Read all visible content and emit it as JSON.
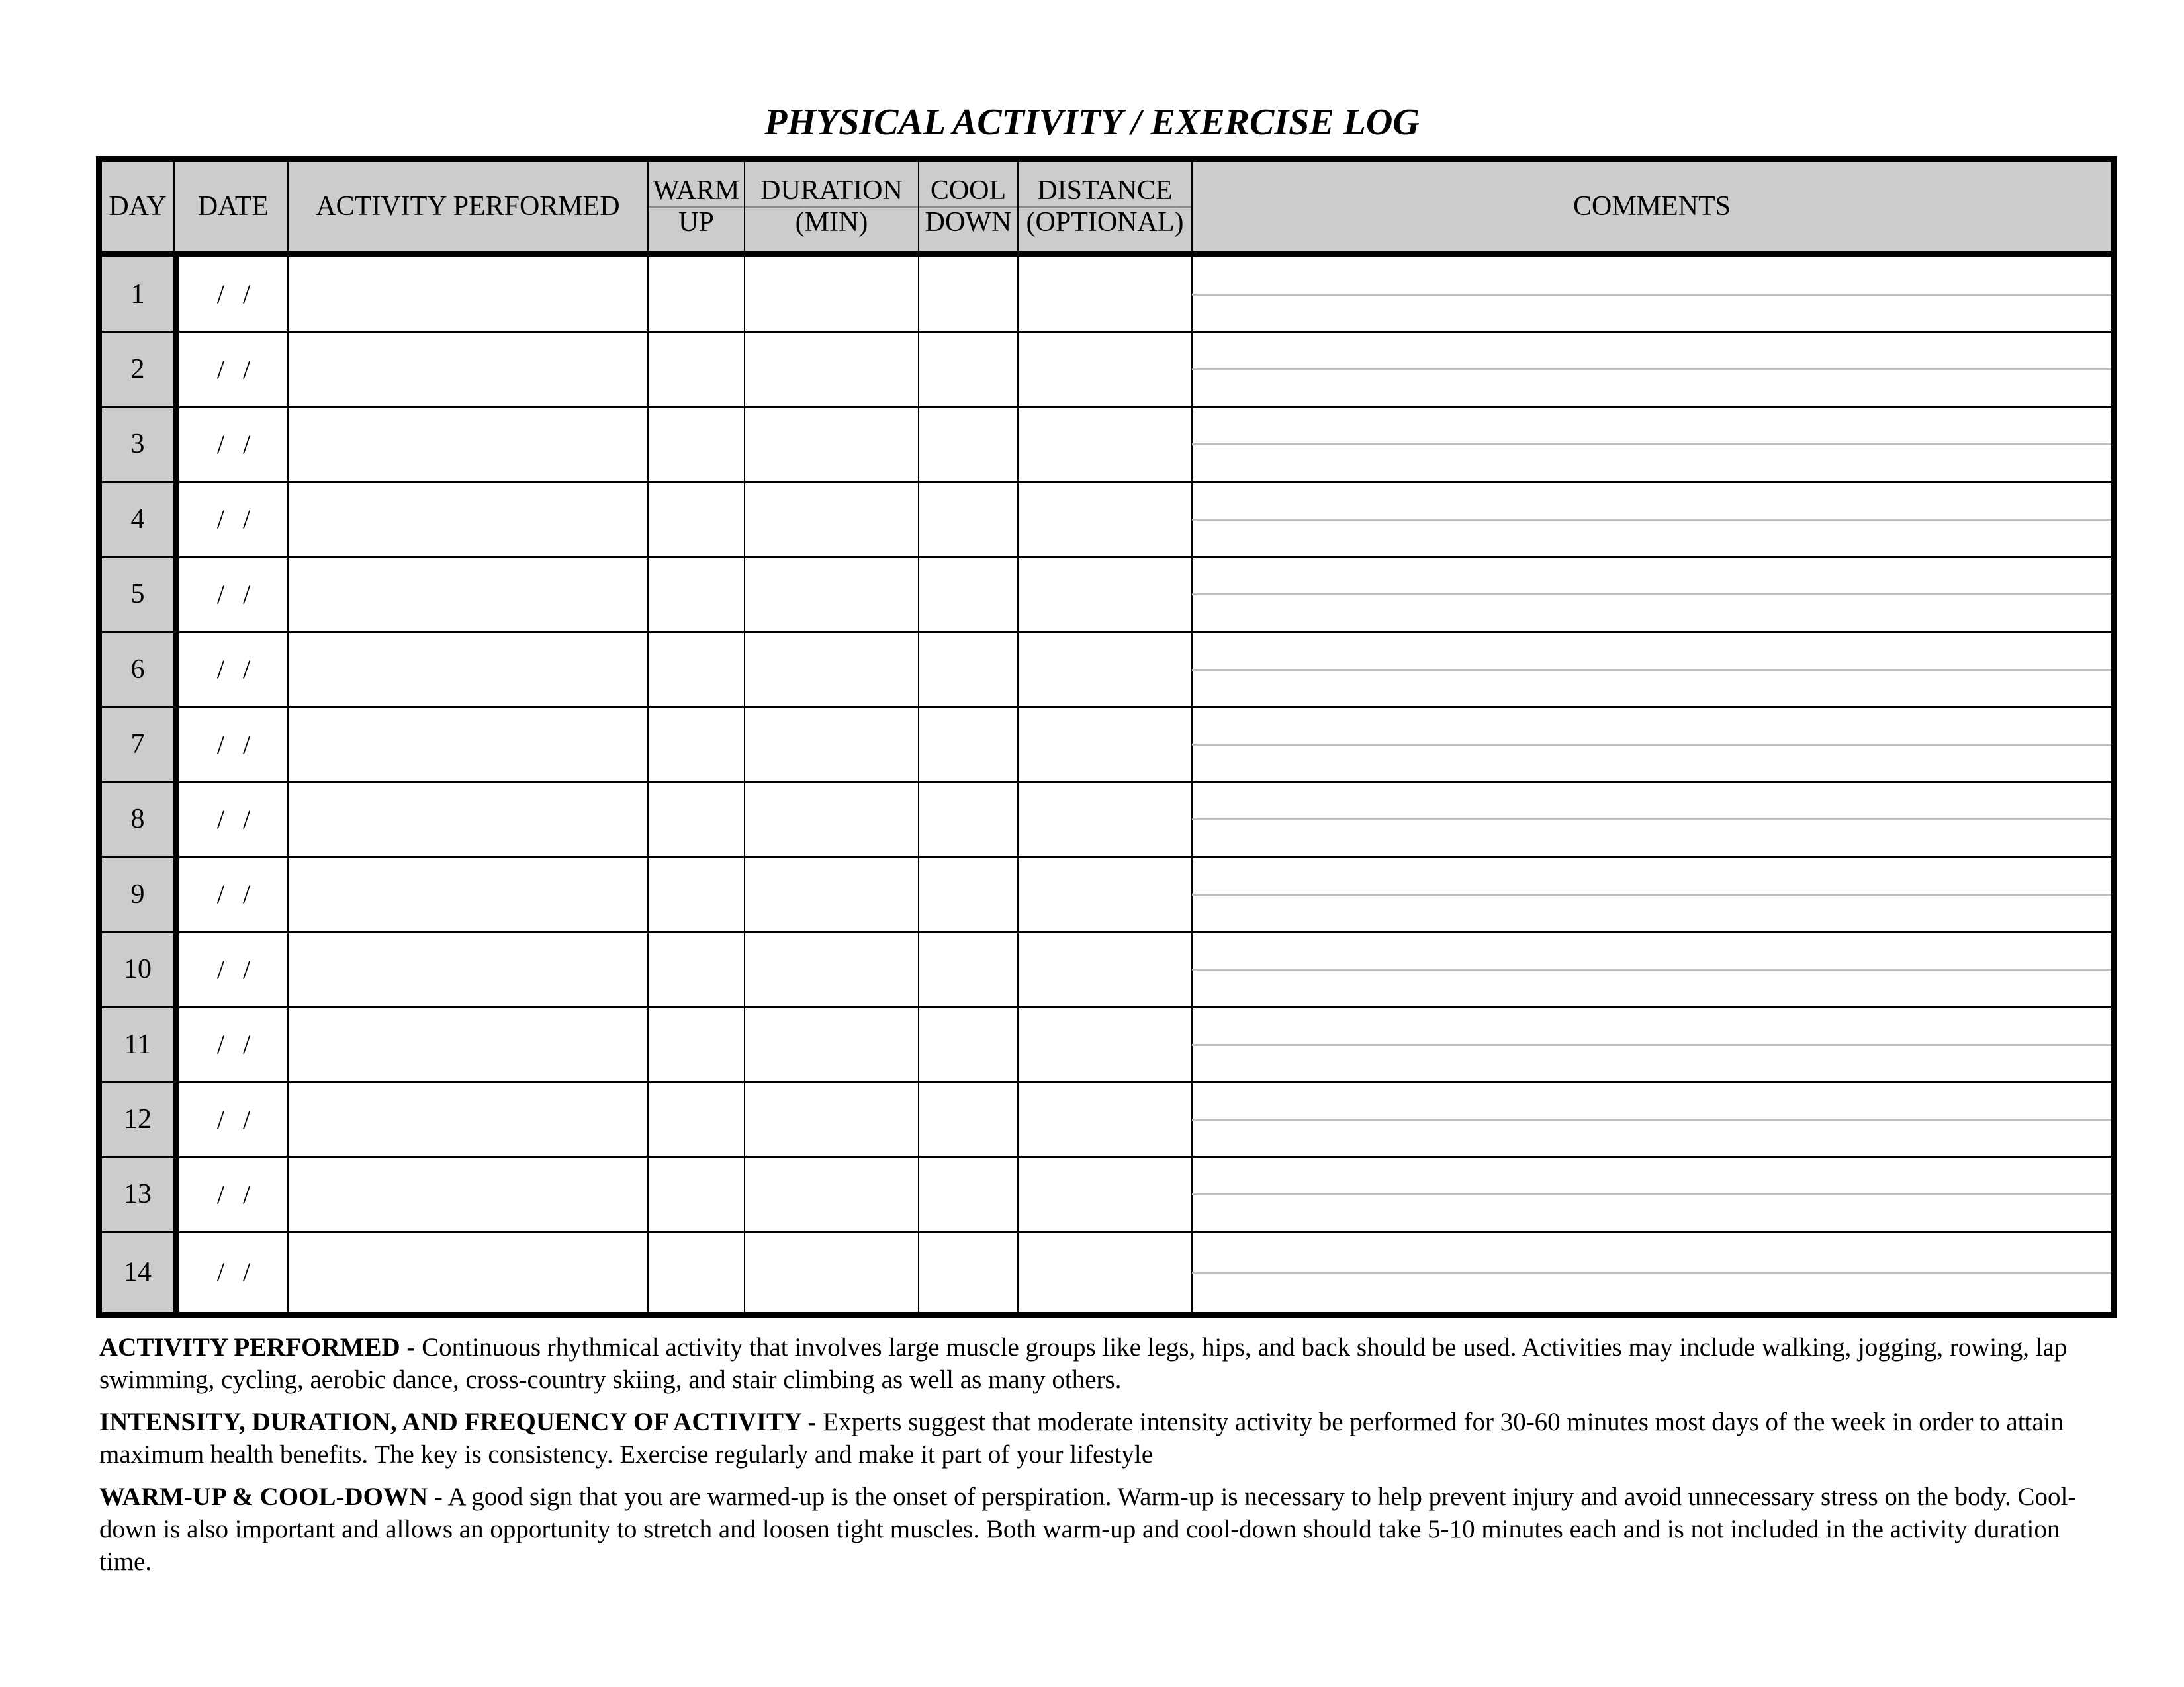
{
  "title": "PHYSICAL ACTIVITY / EXERCISE LOG",
  "columns": [
    {
      "key": "day",
      "line1": "DAY",
      "line2": ""
    },
    {
      "key": "date",
      "line1": "DATE",
      "line2": ""
    },
    {
      "key": "activity",
      "line1": "ACTIVITY PERFORMED",
      "line2": ""
    },
    {
      "key": "warmup",
      "line1": "WARM",
      "line2": "UP"
    },
    {
      "key": "duration",
      "line1": "DURATION",
      "line2": "(MIN)"
    },
    {
      "key": "cooldown",
      "line1": "COOL",
      "line2": "DOWN"
    },
    {
      "key": "distance",
      "line1": "DISTANCE",
      "line2": "(OPTIONAL)"
    },
    {
      "key": "comments",
      "line1": "COMMENTS",
      "line2": ""
    }
  ],
  "rows": [
    {
      "day": "1",
      "date": "/ /"
    },
    {
      "day": "2",
      "date": "/ /"
    },
    {
      "day": "3",
      "date": "/ /"
    },
    {
      "day": "4",
      "date": "/ /"
    },
    {
      "day": "5",
      "date": "/ /"
    },
    {
      "day": "6",
      "date": "/ /"
    },
    {
      "day": "7",
      "date": "/ /"
    },
    {
      "day": "8",
      "date": "/ /"
    },
    {
      "day": "9",
      "date": "/ /"
    },
    {
      "day": "10",
      "date": "/ /"
    },
    {
      "day": "11",
      "date": "/ /"
    },
    {
      "day": "12",
      "date": "/ /"
    },
    {
      "day": "13",
      "date": "/ /"
    },
    {
      "day": "14",
      "date": "/ /"
    }
  ],
  "notes": [
    {
      "heading": "ACTIVITY PERFORMED -",
      "text": "Continuous rhythmical activity that involves large muscle groups like legs, hips, and back should be used.  Activities may include walking, jogging, rowing, lap swimming, cycling, aerobic dance, cross-country skiing, and stair climbing as well as many others."
    },
    {
      "heading": "INTENSITY, DURATION, AND FREQUENCY OF ACTIVITY -",
      "text": "Experts suggest that moderate intensity activity be performed for 30-60 minutes most days of the week in order to attain maximum health benefits.  The key is consistency.  Exercise regularly and make it part of your lifestyle"
    },
    {
      "heading": "WARM-UP & COOL-DOWN -",
      "text": "A good sign that you are warmed-up is the onset of perspiration.  Warm-up is necessary to help prevent injury and avoid unnecessary stress on the body.  Cool-down is also important and allows an opportunity to stretch and loosen tight muscles.  Both warm-up and cool-down should take 5-10 minutes each and is not included in the activity duration time."
    }
  ]
}
